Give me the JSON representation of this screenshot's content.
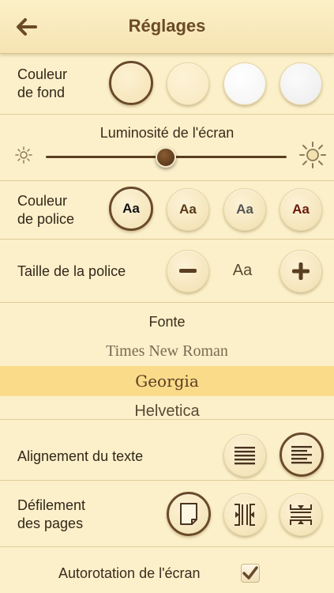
{
  "header": {
    "title": "Réglages",
    "back_icon": "back-arrow-icon"
  },
  "background_color": {
    "label_line1": "Couleur",
    "label_line2": "de fond",
    "swatches": [
      "cream",
      "light-cream",
      "white",
      "paper-white"
    ],
    "selected_index": 0
  },
  "brightness": {
    "label": "Luminosité de l'écran",
    "value_fraction": 0.5
  },
  "font_color": {
    "label_line1": "Couleur",
    "label_line2": "de police",
    "sample": "Aa",
    "options": [
      "#111111",
      "#5a3a14",
      "#555555",
      "#6b1a0a"
    ],
    "selected_index": 0
  },
  "font_size": {
    "label": "Taille de la police",
    "sample": "Aa",
    "minus": "−",
    "plus": "+"
  },
  "font": {
    "heading": "Fonte",
    "items": [
      "Times New Roman",
      "Georgia",
      "Helvetica"
    ],
    "selected": "Georgia"
  },
  "alignment": {
    "label": "Alignement du texte",
    "options": [
      "justify",
      "left"
    ],
    "selected_index": 1
  },
  "paging": {
    "label_line1": "Défilement",
    "label_line2": "des pages",
    "options": [
      "page",
      "horizontal",
      "vertical"
    ],
    "selected_index": 0
  },
  "autorotation": {
    "label": "Autorotation de l'écran",
    "checked": true
  },
  "colors": {
    "accent_brown": "#6a4a2a",
    "background": "#fbf0c9",
    "selected_font_row": "#f9db8a"
  }
}
